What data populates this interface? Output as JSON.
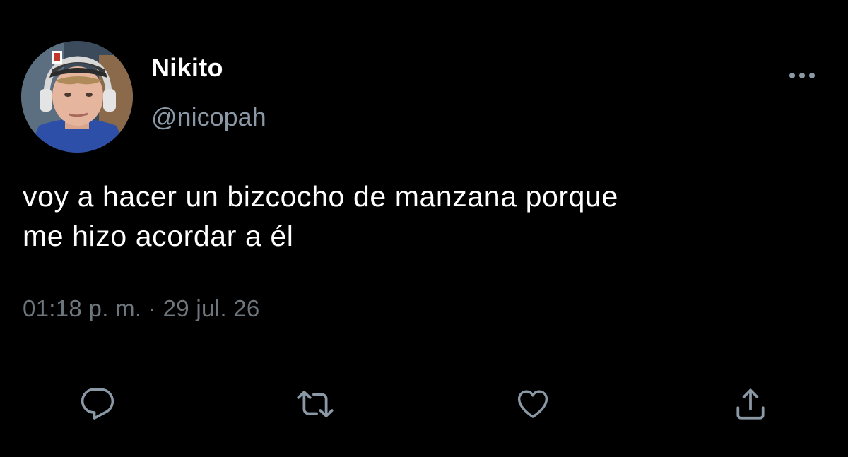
{
  "tweet": {
    "display_name": "Nikito",
    "handle": "@nicopah",
    "text": "voy a hacer un bizcocho de manzana porque\nme hizo acordar a él",
    "timestamp": "01:18 p. m. · 29 jul. 26"
  },
  "icons": {
    "more": "more-horizontal-icon",
    "reply": "reply-icon",
    "retweet": "retweet-icon",
    "like": "heart-icon",
    "share": "share-icon"
  },
  "colors": {
    "background": "#000000",
    "text_primary": "#ffffff",
    "text_secondary": "#6e767d",
    "icon": "#8b98a5",
    "divider": "#2f3336"
  }
}
